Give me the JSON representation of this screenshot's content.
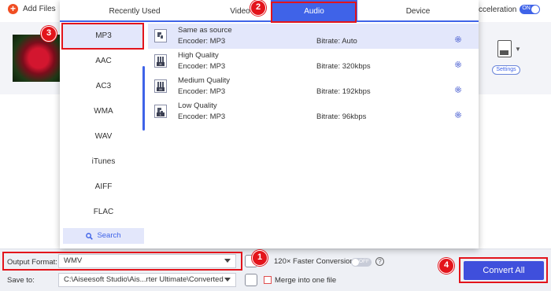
{
  "toolbar": {
    "add_files": "Add Files",
    "acceleration": "cceleration",
    "accel_toggle": "ON"
  },
  "file": {
    "settings_label": "Settings"
  },
  "tabs": [
    {
      "label": "Recently Used"
    },
    {
      "label": "Video"
    },
    {
      "label": "Audio",
      "active": true
    },
    {
      "label": "Device"
    }
  ],
  "formats": [
    {
      "label": "MP3",
      "selected": true
    },
    {
      "label": "AAC"
    },
    {
      "label": "AC3"
    },
    {
      "label": "WMA"
    },
    {
      "label": "WAV"
    },
    {
      "label": "iTunes"
    },
    {
      "label": "AIFF"
    },
    {
      "label": "FLAC"
    }
  ],
  "search_label": "Search",
  "presets": [
    {
      "name": "Same as source",
      "encoder": "Encoder: MP3",
      "bitrate": "Bitrate: Auto",
      "icon_tag": ""
    },
    {
      "name": "High Quality",
      "encoder": "Encoder: MP3",
      "bitrate": "Bitrate: 320kbps",
      "icon_tag": "H"
    },
    {
      "name": "Medium Quality",
      "encoder": "Encoder: MP3",
      "bitrate": "Bitrate: 192kbps",
      "icon_tag": "M"
    },
    {
      "name": "Low Quality",
      "encoder": "Encoder: MP3",
      "bitrate": "Bitrate: 96kbps",
      "icon_tag": "L"
    }
  ],
  "bottom": {
    "output_format_label": "Output Format:",
    "output_format_value": "WMV",
    "speed_text": "120× Faster Conversion",
    "speed_toggle": "OFF",
    "save_to_label": "Save to:",
    "save_to_value": "C:\\Aiseesoft Studio\\Ais...rter Ultimate\\Converted",
    "merge_label": "Merge into one file",
    "convert_all": "Convert All"
  },
  "badges": {
    "b1": "1",
    "b2": "2",
    "b3": "3",
    "b4": "4"
  },
  "colors": {
    "accent": "#3f63e8",
    "annotation": "#e3141b",
    "convert_button": "#3f4fdc"
  }
}
